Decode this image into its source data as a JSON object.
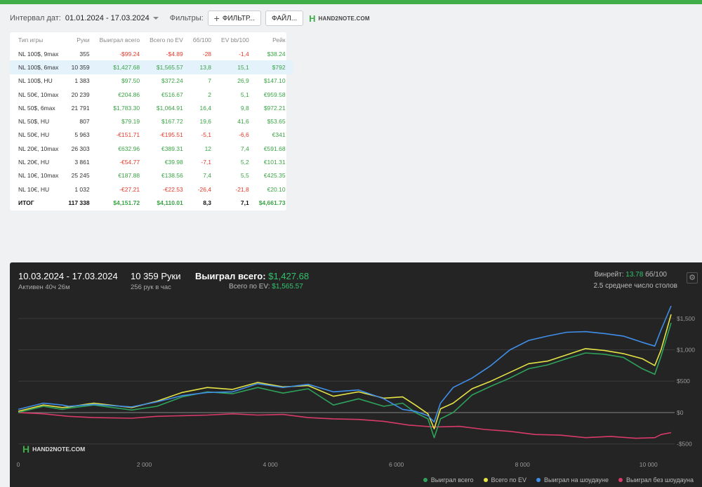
{
  "filters": {
    "date_interval_label": "Интервал дат:",
    "date_range": "01.01.2024 - 17.03.2024",
    "filters_label": "Фильтры:",
    "filter_button": "ФИЛЬТР...",
    "file_button": "ФАЙЛ...",
    "logo_text": "HAND2NOTE.COM"
  },
  "table": {
    "headers": [
      "Тип игры",
      "Руки",
      "Выиграл всего",
      "Всего по EV",
      "бб/100",
      "EV bb/100",
      "Рейк"
    ],
    "rows": [
      [
        "NL 100$, 9max",
        "355",
        "-$99.24",
        "-$4.89",
        "-28",
        "-1,4",
        "$38.24"
      ],
      [
        "NL 100$, 6max",
        "10 359",
        "$1,427.68",
        "$1,565.57",
        "13,8",
        "15,1",
        "$792"
      ],
      [
        "NL 100$, HU",
        "1 383",
        "$97.50",
        "$372.24",
        "7",
        "26,9",
        "$147.10"
      ],
      [
        "NL 50€, 10max",
        "20 239",
        "€204.86",
        "€516.67",
        "2",
        "5,1",
        "€959.58"
      ],
      [
        "NL 50$, 6max",
        "21 791",
        "$1,783.30",
        "$1,064.91",
        "16,4",
        "9,8",
        "$972.21"
      ],
      [
        "NL 50$, HU",
        "807",
        "$79.19",
        "$167.72",
        "19,6",
        "41,6",
        "$53.65"
      ],
      [
        "NL 50€, HU",
        "5 963",
        "-€151.71",
        "-€195.51",
        "-5,1",
        "-6,6",
        "€341"
      ],
      [
        "NL 20€, 10max",
        "26 303",
        "€632.96",
        "€389.31",
        "12",
        "7,4",
        "€591.68"
      ],
      [
        "NL 20€, HU",
        "3 861",
        "-€54.77",
        "€39.98",
        "-7,1",
        "5,2",
        "€101.31"
      ],
      [
        "NL 10€, 10max",
        "25 245",
        "€187.88",
        "€138.56",
        "7,4",
        "5,5",
        "€425.35"
      ],
      [
        "NL 10€, HU",
        "1 032",
        "-€27.21",
        "-€22.53",
        "-26,4",
        "-21,8",
        "€20.10"
      ]
    ],
    "total": [
      "ИТОГ",
      "117 338",
      "$4,151.72",
      "$4,110.01",
      "8,3",
      "7,1",
      "$4,661.73"
    ],
    "selected_row": 1
  },
  "panel": {
    "date_range": "10.03.2024 - 17.03.2024",
    "active_time": "Активен 40ч 26м",
    "hands": "10 359 Руки",
    "hands_rate": "256 рук в час",
    "won_label": "Выиграл всего:",
    "won_value": "$1,427.68",
    "ev_label": "Всего по EV:",
    "ev_value": "$1,565.57",
    "winrate_label": "Винрейт:",
    "winrate_value": "13.78",
    "winrate_unit": "бб/100",
    "avg_tables": "2.5 среднее число столов",
    "gear_icon": "gear-icon",
    "watermark": "HAND2NOTE.COM"
  },
  "chart_data": {
    "type": "line",
    "x_ticks": [
      "0",
      "2 000",
      "4 000",
      "6 000",
      "8 000",
      "10 000"
    ],
    "y_ticks": [
      "$1,500",
      "$1,000",
      "$500",
      "$0",
      "-$500"
    ],
    "xlim": [
      0,
      10359
    ],
    "ylim": [
      -650,
      1700
    ],
    "grid": true,
    "legend_position": "bottom-right",
    "series": [
      {
        "name": "Выиграл всего",
        "color": "#2ea25a",
        "x": [
          0,
          400,
          700,
          800,
          1200,
          1800,
          2200,
          2600,
          3000,
          3400,
          3800,
          4200,
          4600,
          5000,
          5400,
          5800,
          6100,
          6300,
          6500,
          6600,
          6700,
          6900,
          7200,
          7500,
          7800,
          8100,
          8400,
          8700,
          9000,
          9300,
          9600,
          9900,
          10100,
          10200,
          10359
        ],
        "y": [
          0,
          100,
          50,
          70,
          120,
          40,
          100,
          250,
          330,
          300,
          400,
          310,
          380,
          120,
          220,
          100,
          150,
          0,
          -100,
          -400,
          -100,
          0,
          280,
          420,
          550,
          700,
          760,
          860,
          950,
          930,
          880,
          700,
          610,
          900,
          1430
        ]
      },
      {
        "name": "Всего по EV",
        "color": "#e3e346",
        "x": [
          0,
          400,
          700,
          800,
          1200,
          1800,
          2200,
          2600,
          3000,
          3400,
          3800,
          4200,
          4600,
          5000,
          5400,
          5800,
          6100,
          6300,
          6500,
          6600,
          6700,
          6900,
          7200,
          7500,
          7800,
          8100,
          8400,
          8700,
          9000,
          9300,
          9600,
          9900,
          10100,
          10200,
          10359
        ],
        "y": [
          20,
          120,
          80,
          90,
          150,
          80,
          180,
          320,
          400,
          370,
          480,
          410,
          430,
          260,
          330,
          230,
          250,
          120,
          -20,
          -260,
          60,
          150,
          380,
          500,
          640,
          780,
          820,
          920,
          1020,
          990,
          940,
          860,
          750,
          1000,
          1566
        ]
      },
      {
        "name": "Выиграл на шоудауне",
        "color": "#3f8ee8",
        "x": [
          0,
          400,
          700,
          800,
          1200,
          1800,
          2200,
          2600,
          3000,
          3400,
          3800,
          4200,
          4600,
          5000,
          5400,
          5800,
          6100,
          6300,
          6500,
          6600,
          6700,
          6900,
          7200,
          7500,
          7800,
          8100,
          8400,
          8700,
          9000,
          9300,
          9600,
          9900,
          10100,
          10200,
          10359
        ],
        "y": [
          50,
          150,
          120,
          100,
          130,
          90,
          170,
          270,
          320,
          330,
          460,
          400,
          450,
          330,
          360,
          220,
          50,
          20,
          -50,
          -150,
          150,
          400,
          550,
          750,
          1000,
          1150,
          1220,
          1280,
          1290,
          1260,
          1220,
          1120,
          1060,
          1320,
          1700
        ]
      },
      {
        "name": "Выиграл без шоудауна",
        "color": "#d83a6a",
        "x": [
          0,
          400,
          800,
          1200,
          1800,
          2200,
          2600,
          3000,
          3400,
          3800,
          4200,
          4600,
          5000,
          5400,
          5800,
          6200,
          6600,
          7000,
          7400,
          7800,
          8200,
          8600,
          9000,
          9400,
          9800,
          10100,
          10200,
          10359
        ],
        "y": [
          0,
          -20,
          -60,
          -80,
          -90,
          -60,
          -50,
          -40,
          -20,
          -40,
          -30,
          -80,
          -100,
          -110,
          -140,
          -200,
          -230,
          -220,
          -270,
          -300,
          -350,
          -360,
          -400,
          -380,
          -410,
          -400,
          -350,
          -320
        ]
      }
    ]
  }
}
